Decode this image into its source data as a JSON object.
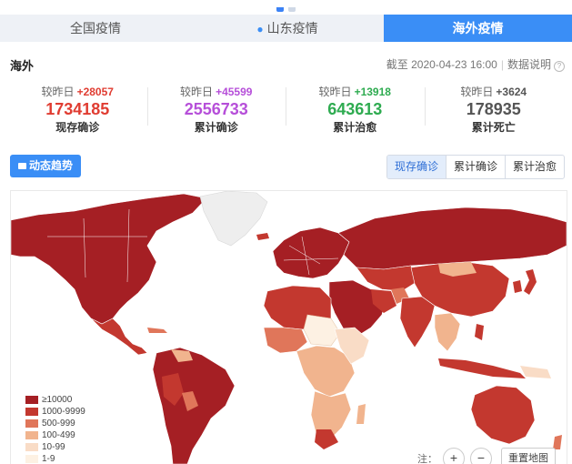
{
  "tabs": [
    {
      "label": "全国疫情",
      "active": false
    },
    {
      "label": "山东疫情",
      "active": false
    },
    {
      "label": "海外疫情",
      "active": true
    }
  ],
  "header": {
    "region": "海外",
    "as_of": "截至 2020-04-23 16:00",
    "data_note": "数据说明"
  },
  "stats": [
    {
      "delta_label": "较昨日",
      "delta": "+28057",
      "value": "1734185",
      "label": "现存确诊",
      "color": "#e03c31"
    },
    {
      "delta_label": "较昨日",
      "delta": "+45599",
      "value": "2556733",
      "label": "累计确诊",
      "color": "#b64fd9"
    },
    {
      "delta_label": "较昨日",
      "delta": "+13918",
      "value": "643613",
      "label": "累计治愈",
      "color": "#2eab50"
    },
    {
      "delta_label": "较昨日",
      "delta": "+3624",
      "value": "178935",
      "label": "累计死亡",
      "color": "#555555"
    }
  ],
  "trend_button": "动态趋势",
  "segments": [
    "现存确诊",
    "累计确诊",
    "累计治愈"
  ],
  "legend": [
    {
      "label": "≥10000",
      "color": "#a51f24"
    },
    {
      "label": "1000-9999",
      "color": "#c3382f"
    },
    {
      "label": "500-999",
      "color": "#e0765a"
    },
    {
      "label": "100-499",
      "color": "#f1b48e"
    },
    {
      "label": "10-99",
      "color": "#f9dcc6"
    },
    {
      "label": "1-9",
      "color": "#fdf1e3"
    }
  ],
  "map": {
    "note": "注：",
    "zoom_in": "+",
    "zoom_out": "−",
    "reset": "重置地图"
  }
}
